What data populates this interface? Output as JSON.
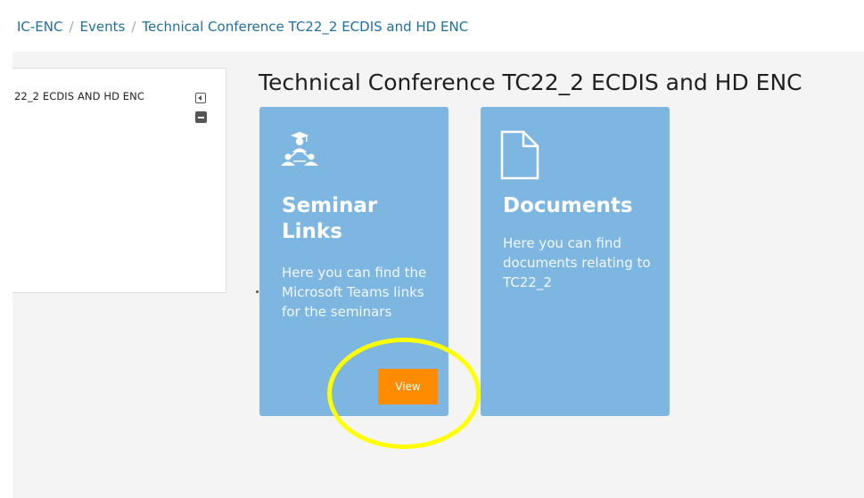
{
  "breadcrumb": {
    "items": [
      "IC-ENC",
      "Events",
      "Technical Conference TC22_2 ECDIS and HD ENC"
    ],
    "separator": "/"
  },
  "side_panel": {
    "title": "22_2 ECDIS AND HD ENC"
  },
  "page": {
    "title": "Technical Conference TC22_2 ECDIS and HD ENC"
  },
  "cards": [
    {
      "icon": "hierarchy-users-icon",
      "title": "Seminar Links",
      "description": "Here you can find the Microsoft Teams links for the seminars",
      "button_label": "View"
    },
    {
      "icon": "document-icon",
      "title": "Documents",
      "description": "Here you can find documents relating to TC22_2"
    }
  ],
  "colors": {
    "card_bg": "#7db6e1",
    "link": "#1f6f9c",
    "button": "#ff8c00",
    "highlight": "#ffff00"
  }
}
